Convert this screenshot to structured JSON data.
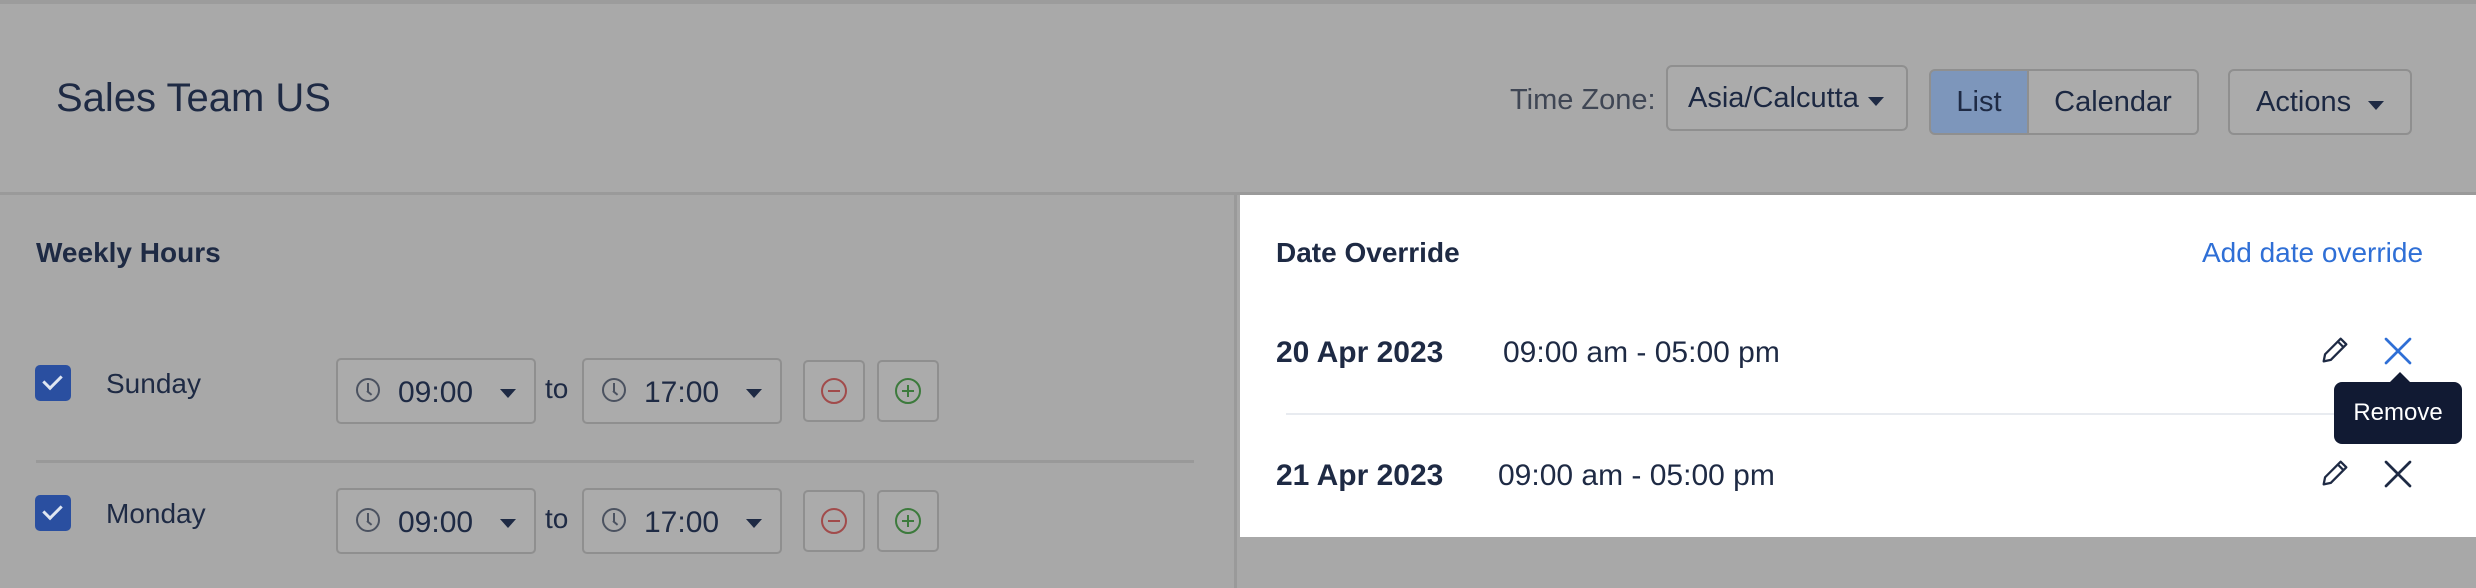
{
  "header": {
    "title": "Sales Team US",
    "timezone_label": "Time Zone:",
    "timezone_value": "Asia/Calcutta",
    "views": [
      "List",
      "Calendar"
    ],
    "active_view": "List",
    "actions_label": "Actions"
  },
  "weekly_hours": {
    "title": "Weekly Hours",
    "days": [
      {
        "name": "Sunday",
        "checked": true,
        "start": "09:00",
        "end": "17:00",
        "separator": "to"
      },
      {
        "name": "Monday",
        "checked": true,
        "start": "09:00",
        "end": "17:00",
        "separator": "to"
      }
    ]
  },
  "date_override": {
    "title": "Date Override",
    "add_label": "Add date override",
    "items": [
      {
        "date": "20 Apr 2023",
        "time": "09:00 am - 05:00 pm"
      },
      {
        "date": "21 Apr 2023",
        "time": "09:00 am - 05:00 pm"
      }
    ],
    "tooltip": "Remove"
  },
  "colors": {
    "accent": "#2f6fd6",
    "overlay": "#a8a8a8",
    "checkbox": "#2a4fa0",
    "remove_red": "#a14b4b",
    "add_green": "#3c7a3c",
    "tooltip_bg": "#111a33"
  }
}
